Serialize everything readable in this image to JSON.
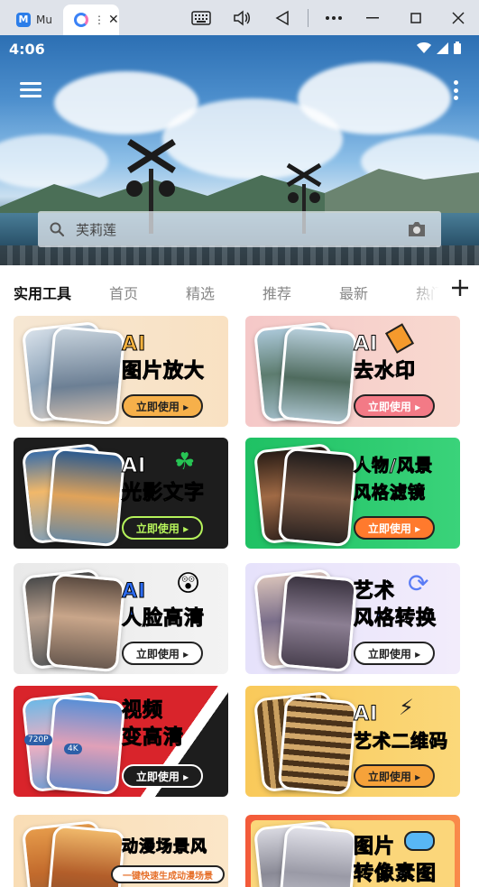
{
  "window": {
    "tabs": [
      {
        "label": "Mu"
      },
      {
        "label": "⋮"
      }
    ]
  },
  "status_bar": {
    "time": "4:06"
  },
  "search": {
    "placeholder": "芙莉莲"
  },
  "tabs": [
    {
      "label": "实用工具",
      "active": true
    },
    {
      "label": "首页"
    },
    {
      "label": "精选"
    },
    {
      "label": "推荐"
    },
    {
      "label": "最新"
    },
    {
      "label": "热门"
    }
  ],
  "cards": [
    {
      "title": [
        "AI",
        "图片放大"
      ],
      "button": "立即使用 ▸"
    },
    {
      "title": [
        "AI",
        "去水印"
      ],
      "button": "立即使用 ▸"
    },
    {
      "title": [
        "AI",
        "光影文字"
      ],
      "button": "立即使用 ▸"
    },
    {
      "title": [
        "人物/风景",
        "风格滤镜"
      ],
      "button": "立即使用 ▸"
    },
    {
      "title": [
        "AI",
        "人脸高清"
      ],
      "button": "立即使用 ▸"
    },
    {
      "title": [
        "艺术",
        "风格转换"
      ],
      "button": "立即使用 ▸"
    },
    {
      "title": [
        "视频",
        "变高清"
      ],
      "button": "立即使用 ▸"
    },
    {
      "title": [
        "AI",
        "艺术二维码"
      ],
      "button": "立即使用 ▸"
    },
    {
      "title": [
        "动漫场景风"
      ],
      "button": "一键快速生成动漫场景"
    },
    {
      "title": [
        "图片",
        "转像素图"
      ],
      "button": ""
    }
  ],
  "badges": {
    "res_low": "720P",
    "res_high": "4K"
  }
}
